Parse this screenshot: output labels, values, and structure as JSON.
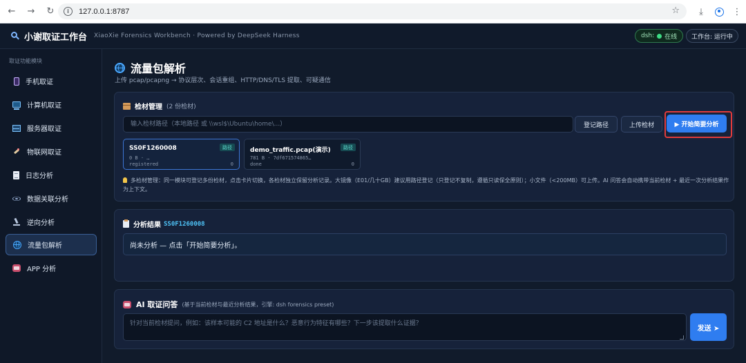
{
  "browser": {
    "url": "127.0.0.1:8787",
    "back_icon": "arrow-left-icon",
    "forward_icon": "arrow-right-icon",
    "reload_icon": "reload-icon"
  },
  "header": {
    "title": "小谢取证工作台",
    "subtitle": "XiaoXie Forensics Workbench · Powered by DeepSeek Harness",
    "dsh_label": "dsh:",
    "dsh_status": "在线",
    "work_status": "工作台: 运行中"
  },
  "sidebar": {
    "heading": "取证功能模块",
    "items": [
      {
        "label": "手机取证",
        "icon": "phone-icon"
      },
      {
        "label": "计算机取证",
        "icon": "computer-icon"
      },
      {
        "label": "服务器取证",
        "icon": "server-icon"
      },
      {
        "label": "物联网取证",
        "icon": "iot-icon"
      },
      {
        "label": "日志分析",
        "icon": "log-icon"
      },
      {
        "label": "数据关联分析",
        "icon": "atom-icon"
      },
      {
        "label": "逆向分析",
        "icon": "microscope-icon"
      },
      {
        "label": "流量包解析",
        "icon": "globe-icon",
        "active": true
      },
      {
        "label": "APP 分析",
        "icon": "app-icon"
      }
    ]
  },
  "page": {
    "title": "流量包解析",
    "subtitle": "上传 pcap/pcapng → 协议层次、会话重组、HTTP/DNS/TLS 提取、可疑通信"
  },
  "evidence": {
    "heading": "检材管理",
    "count": "(2 份检材)",
    "path_placeholder": "输入检材路径（本地路径 或 \\\\wsl$\\Ubuntu\\home\\...）",
    "register_label": "登记路径",
    "upload_label": "上传检材",
    "analyze_label": "▶ 开始简要分析",
    "cards": [
      {
        "name": "SS0F1260008",
        "tag": "路径",
        "meta": "0 B · …",
        "status": "registered",
        "num": "0",
        "selected": true
      },
      {
        "name": "demo_traffic.pcap(演示)",
        "tag": "路径",
        "meta": "781 B · 7df6715748​65…",
        "status": "done",
        "num": "0",
        "selected": false
      }
    ],
    "tip": "多检材管理：同一模块可登记多份检材，点击卡片切换，各检材独立保留分析记录。大镜像（E01/几十GB）建议用路径登记（只登记不复制，遵循只读保全原则）；小文件（<200MB）可上传。AI 问答会自动携带当前检材 + 最近一次分析结果作为上下文。"
  },
  "result": {
    "heading": "分析结果",
    "evidence_id": "SS0F1260008",
    "text": "尚未分析 — 点击「开始简要分析」。"
  },
  "qa": {
    "heading": "AI 取证问答",
    "hint": "(基于当前检材与最近分析结果，引擎: dsh forensics preset)",
    "placeholder": "针对当前检材提问，例如：该样本可能的 C2 地址是什么？恶意行为特征有哪些？下一步该提取什么证据？",
    "send_label": "发送 ➤"
  },
  "colors": {
    "accent": "#2f7df0",
    "online": "#3ddc84",
    "highlight": "#e23b3b",
    "tag": "#5fe0d0"
  }
}
